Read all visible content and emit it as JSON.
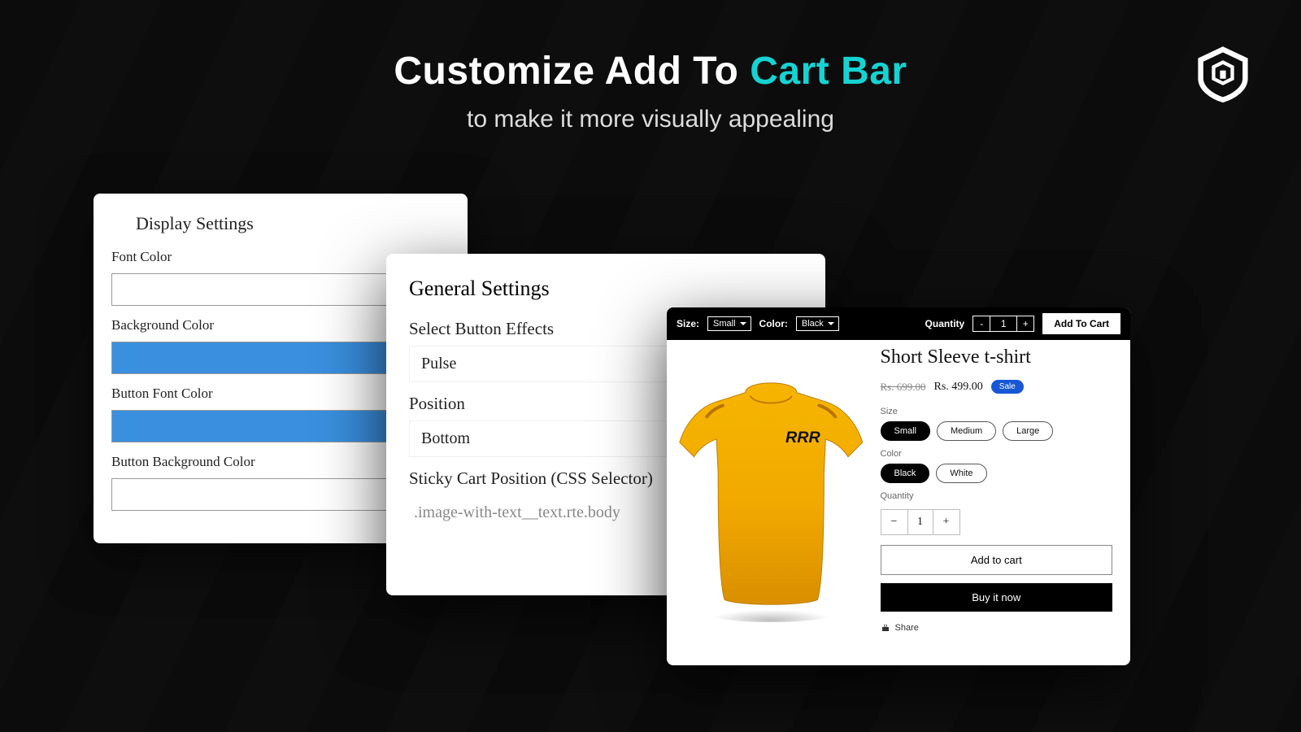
{
  "hero": {
    "title_pre": "Customize Add To ",
    "title_accent": "Cart Bar",
    "subtitle": "to make it more visually appealing"
  },
  "display_panel": {
    "heading": "Display Settings",
    "fields": [
      {
        "label": "Font Color",
        "value": "#ffffff"
      },
      {
        "label": "Background Color",
        "value": "#3a8fde"
      },
      {
        "label": "Button Font Color",
        "value": "#3a8fde"
      },
      {
        "label": "Button Background Color",
        "value": "#ffffff"
      }
    ]
  },
  "general_panel": {
    "heading": "General Settings",
    "button_effects_label": "Select Button Effects",
    "button_effects_value": "Pulse",
    "position_label": "Position",
    "position_value": "Bottom",
    "css_label": "Sticky Cart Position (CSS Selector)",
    "css_value": ".image-with-text__text.rte.body"
  },
  "cart_bar": {
    "size_label": "Size:",
    "size_value": "Small",
    "color_label": "Color:",
    "color_value": "Black",
    "qty_label": "Quantity",
    "qty_minus": "-",
    "qty_value": "1",
    "qty_plus": "+",
    "add_button": "Add To Cart"
  },
  "product": {
    "title": "Short Sleeve t-shirt",
    "price_old": "Rs. 699.00",
    "price_new": "Rs. 499.00",
    "sale_label": "Sale",
    "size_label": "Size",
    "sizes": [
      "Small",
      "Medium",
      "Large"
    ],
    "size_selected": "Small",
    "color_label": "Color",
    "colors": [
      "Black",
      "White"
    ],
    "color_selected": "Black",
    "qty_label": "Quantity",
    "qty_minus": "−",
    "qty_value": "1",
    "qty_plus": "+",
    "add_to_cart": "Add to cart",
    "buy_now": "Buy it now",
    "share": "Share"
  }
}
